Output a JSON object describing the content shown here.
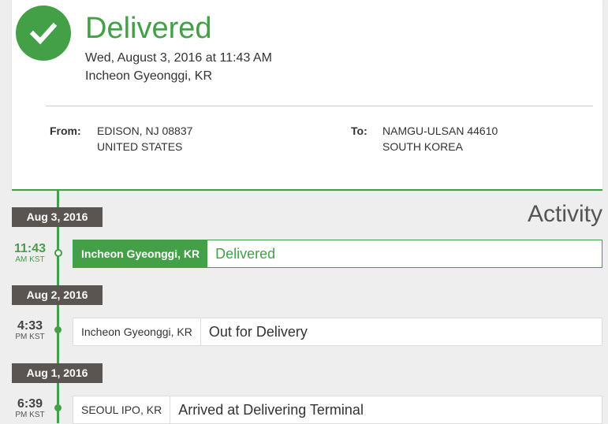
{
  "summary": {
    "status": "Delivered",
    "date": "Wed, August 3, 2016 at 11:43 AM",
    "location": "Incheon Gyeonggi, KR",
    "from_label": "From:",
    "from_line1": "EDISON, NJ 08837",
    "from_line2": "UNITED STATES",
    "to_label": "To:",
    "to_line1": "NAMGU-ULSAN 44610",
    "to_line2": "SOUTH KOREA",
    "status_icon": "checkmark-icon"
  },
  "activity": {
    "heading": "Activity",
    "days": [
      {
        "date": "Aug 3, 2016",
        "events": [
          {
            "time": "11:43",
            "tz": "AM KST",
            "location": "Incheon Gyeonggi, KR",
            "status": "Delivered",
            "current": true
          }
        ]
      },
      {
        "date": "Aug 2, 2016",
        "events": [
          {
            "time": "4:33",
            "tz": "PM KST",
            "location": "Incheon Gyeonggi, KR",
            "status": "Out for Delivery",
            "current": false
          }
        ]
      },
      {
        "date": "Aug 1, 2016",
        "events": [
          {
            "time": "6:39",
            "tz": "PM KST",
            "location": "SEOUL IPO, KR",
            "status": "Arrived at Delivering Terminal",
            "current": false
          }
        ]
      }
    ]
  },
  "colors": {
    "accent": "#43a047",
    "date_chip": "#5a5551",
    "background": "#eeeeee"
  }
}
